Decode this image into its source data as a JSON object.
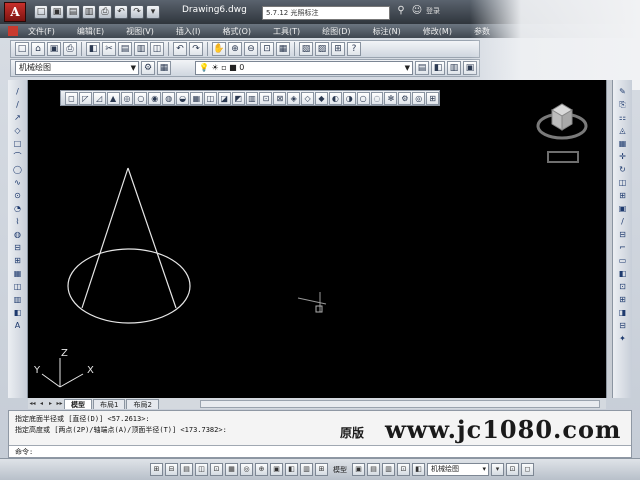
{
  "titlebar": {
    "logo": "A",
    "quick_access": [
      "□",
      "▣",
      "▤",
      "▥",
      "⎙",
      "↶",
      "↷",
      "▾"
    ],
    "document_title": "Drawing6.dwg",
    "search_input": "5.7.12 光照标注",
    "user_label": "登录"
  },
  "menu": {
    "items": [
      "文件(F)",
      "编辑(E)",
      "视图(V)",
      "插入(I)",
      "格式(O)",
      "工具(T)",
      "绘图(D)",
      "标注(N)",
      "修改(M)",
      "参数"
    ]
  },
  "toolbar_standard": {
    "icons": [
      "□",
      "⌂",
      "▣",
      "⎙",
      "◧",
      "✂",
      "▤",
      "▥",
      "◫",
      "↶",
      "↷",
      "✋",
      "⊕",
      "⊖",
      "⊡",
      "▦",
      "▧",
      "▨",
      "⊞",
      "?"
    ]
  },
  "toolbar_layers": {
    "workspace": "机械绘图",
    "layer_value": "0",
    "icons_left": [
      "⚙",
      "▦"
    ],
    "icons_right": [
      "▤",
      "◧",
      "▥",
      "▣"
    ]
  },
  "floating_toolbar": {
    "icons": [
      "◻",
      "◸",
      "◿",
      "▲",
      "◎",
      "○",
      "◉",
      "◍",
      "◒",
      "▦",
      "◫",
      "◪",
      "◩",
      "▥",
      "⊡",
      "⊠",
      "◈",
      "◇",
      "◆",
      "◐",
      "◑",
      "○",
      "◌",
      "✻",
      "⚙",
      "◎",
      "⊞"
    ]
  },
  "left_toolbar": {
    "icons": [
      "/",
      "∕",
      "↗",
      "◇",
      "□",
      "⌒",
      "◯",
      "∿",
      "⊙",
      "◔",
      "⌇",
      "◍",
      "⊟",
      "⊞",
      "▦",
      "◫",
      "▥",
      "◧",
      "A"
    ]
  },
  "right_toolbar": {
    "icons": [
      "✎",
      "⎘",
      "⚏",
      "◬",
      "▦",
      "✛",
      "↻",
      "◫",
      "⊞",
      "▣",
      "/",
      "⊟",
      "⌐",
      "▭",
      "◧",
      "⊡",
      "⊞",
      "◨",
      "⊟",
      "✦"
    ]
  },
  "ucs": {
    "x": "X",
    "y": "Y",
    "z": "Z"
  },
  "tabs": {
    "nav": [
      "◂◂",
      "◂",
      "▸",
      "▸▸"
    ],
    "items": [
      "模型",
      "布局1",
      "布局2"
    ],
    "active": 0
  },
  "command": {
    "history_1": "指定底面半径或 [直径(D)] <57.2613>:",
    "history_2": "指定高度或 [两点(2P)/轴端点(A)/顶面半径(T)] <173.7382>:",
    "prompt": "命令:"
  },
  "watermark": {
    "label": "原版",
    "url": "www.jc1080.com"
  },
  "statusbar": {
    "left_icons": [
      "⊞",
      "⊟",
      "▤",
      "◫",
      "⊡",
      "▦",
      "◎",
      "⊕",
      "▣",
      "◧",
      "▥",
      "⊞"
    ],
    "model_label": "模型",
    "right_icons": [
      "▣",
      "▤",
      "▥",
      "⊡",
      "◧"
    ],
    "workspace": "机械绘图",
    "tail_icons": [
      "▾",
      "⊡",
      "◻"
    ]
  },
  "chart_colors": {
    "canvas": "#000000",
    "geometry": "#e8e8e8"
  }
}
